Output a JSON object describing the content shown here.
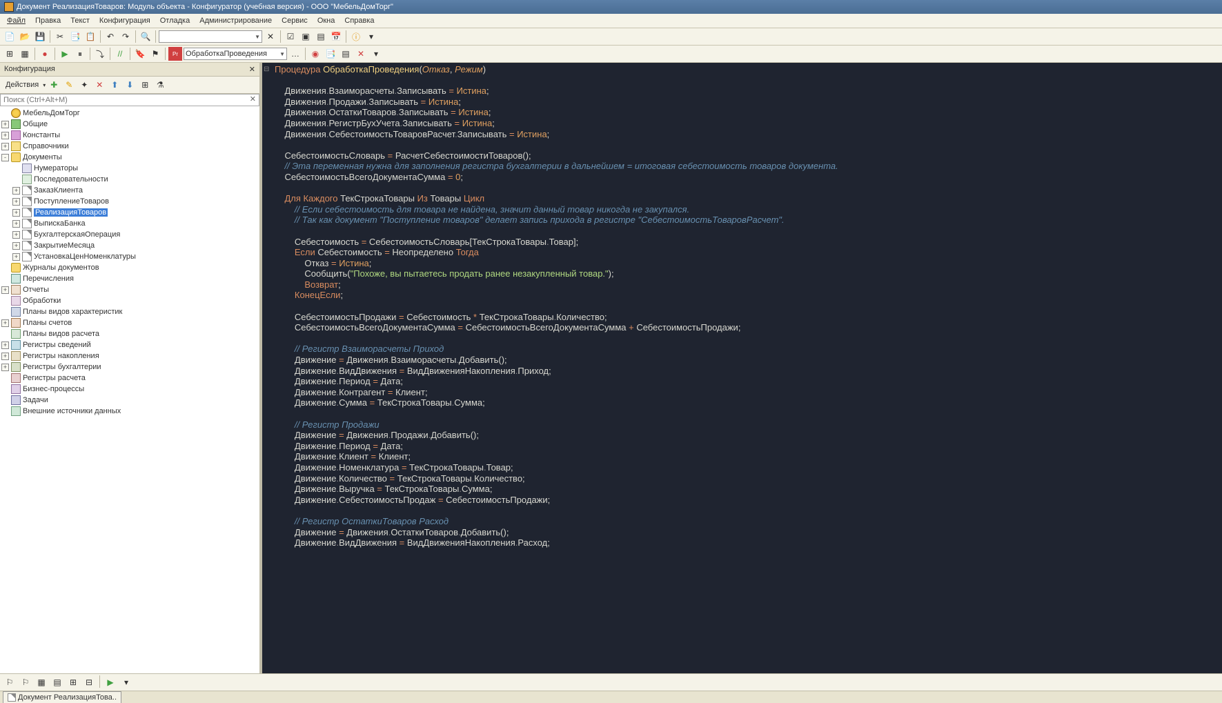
{
  "title": "Документ РеализацияТоваров: Модуль объекта - Конфигуратор (учебная версия) - ООО \"МебельДомТорг\"",
  "menu": [
    "Файл",
    "Правка",
    "Текст",
    "Конфигурация",
    "Отладка",
    "Администрирование",
    "Сервис",
    "Окна",
    "Справка"
  ],
  "proc_combo": "ОбработкаПроведения",
  "sidebar": {
    "title": "Конфигурация",
    "actions": "Действия",
    "search_placeholder": "Поиск (Ctrl+Alt+M)",
    "root": "МебельДомТорг",
    "nodes": [
      {
        "l": "Общие",
        "i": "node",
        "e": "+"
      },
      {
        "l": "Константы",
        "i": "const",
        "e": "+"
      },
      {
        "l": "Справочники",
        "i": "book",
        "e": "+"
      },
      {
        "l": "Документы",
        "i": "folder",
        "e": "-",
        "open": true
      },
      {
        "l": "Журналы документов",
        "i": "folder",
        "e": ""
      },
      {
        "l": "Перечисления",
        "i": "enum",
        "e": ""
      },
      {
        "l": "Отчеты",
        "i": "report",
        "e": "+"
      },
      {
        "l": "Обработки",
        "i": "proc",
        "e": ""
      },
      {
        "l": "Планы видов характеристик",
        "i": "char",
        "e": ""
      },
      {
        "l": "Планы счетов",
        "i": "acct",
        "e": "+"
      },
      {
        "l": "Планы видов расчета",
        "i": "calc",
        "e": ""
      },
      {
        "l": "Регистры сведений",
        "i": "reg",
        "e": "+"
      },
      {
        "l": "Регистры накопления",
        "i": "reg2",
        "e": "+"
      },
      {
        "l": "Регистры бухгалтерии",
        "i": "reg3",
        "e": "+"
      },
      {
        "l": "Регистры расчета",
        "i": "reg4",
        "e": ""
      },
      {
        "l": "Бизнес-процессы",
        "i": "biz",
        "e": ""
      },
      {
        "l": "Задачи",
        "i": "task",
        "e": ""
      },
      {
        "l": "Внешние источники данных",
        "i": "ext",
        "e": ""
      }
    ],
    "docs_children": [
      {
        "l": "Нумераторы",
        "i": "num",
        "e": ""
      },
      {
        "l": "Последовательности",
        "i": "seq",
        "e": ""
      },
      {
        "l": "ЗаказКлиента",
        "i": "doc",
        "e": "+"
      },
      {
        "l": "ПоступлениеТоваров",
        "i": "doc",
        "e": "+"
      },
      {
        "l": "РеализацияТоваров",
        "i": "doc",
        "e": "+",
        "sel": true
      },
      {
        "l": "ВыпискаБанка",
        "i": "doc",
        "e": "+"
      },
      {
        "l": "БухгалтерскаяОперация",
        "i": "doc",
        "e": "+"
      },
      {
        "l": "ЗакрытиеМесяца",
        "i": "doc",
        "e": "+"
      },
      {
        "l": "УстановкаЦенНоменклатуры",
        "i": "doc",
        "e": "+"
      }
    ]
  },
  "tab": "Документ РеализацияТова..",
  "code_lines": [
    [
      {
        "t": "Процедура ",
        "c": "kw"
      },
      {
        "t": "ОбработкаПроведения",
        "c": "fn"
      },
      {
        "t": "(",
        "c": "pn"
      },
      {
        "t": "Отказ",
        "c": "prm"
      },
      {
        "t": ", ",
        "c": "pn"
      },
      {
        "t": "Режим",
        "c": "prm"
      },
      {
        "t": ")",
        "c": "pn"
      }
    ],
    [],
    [
      {
        "t": "    Движения",
        "c": "id"
      },
      {
        "t": ".",
        "c": "dot"
      },
      {
        "t": "Взаиморасчеты",
        "c": "id"
      },
      {
        "t": ".",
        "c": "dot"
      },
      {
        "t": "Записывать ",
        "c": "id"
      },
      {
        "t": "= ",
        "c": "op"
      },
      {
        "t": "Истина",
        "c": "lit"
      },
      {
        "t": ";",
        "c": "pn"
      }
    ],
    [
      {
        "t": "    Движения",
        "c": "id"
      },
      {
        "t": ".",
        "c": "dot"
      },
      {
        "t": "Продажи",
        "c": "id"
      },
      {
        "t": ".",
        "c": "dot"
      },
      {
        "t": "Записывать ",
        "c": "id"
      },
      {
        "t": "= ",
        "c": "op"
      },
      {
        "t": "Истина",
        "c": "lit"
      },
      {
        "t": ";",
        "c": "pn"
      }
    ],
    [
      {
        "t": "    Движения",
        "c": "id"
      },
      {
        "t": ".",
        "c": "dot"
      },
      {
        "t": "ОстаткиТоваров",
        "c": "id"
      },
      {
        "t": ".",
        "c": "dot"
      },
      {
        "t": "Записывать ",
        "c": "id"
      },
      {
        "t": "= ",
        "c": "op"
      },
      {
        "t": "Истина",
        "c": "lit"
      },
      {
        "t": ";",
        "c": "pn"
      }
    ],
    [
      {
        "t": "    Движения",
        "c": "id"
      },
      {
        "t": ".",
        "c": "dot"
      },
      {
        "t": "РегистрБухУчета",
        "c": "id"
      },
      {
        "t": ".",
        "c": "dot"
      },
      {
        "t": "Записывать ",
        "c": "id"
      },
      {
        "t": "= ",
        "c": "op"
      },
      {
        "t": "Истина",
        "c": "lit"
      },
      {
        "t": ";",
        "c": "pn"
      }
    ],
    [
      {
        "t": "    Движения",
        "c": "id"
      },
      {
        "t": ".",
        "c": "dot"
      },
      {
        "t": "СебестоимостьТоваровРасчет",
        "c": "id"
      },
      {
        "t": ".",
        "c": "dot"
      },
      {
        "t": "Записывать ",
        "c": "id"
      },
      {
        "t": "= ",
        "c": "op"
      },
      {
        "t": "Истина",
        "c": "lit"
      },
      {
        "t": ";",
        "c": "pn"
      }
    ],
    [],
    [
      {
        "t": "    СебестоимостьСловарь ",
        "c": "id"
      },
      {
        "t": "= ",
        "c": "op"
      },
      {
        "t": "РасчетСебестоимостиТоваров",
        "c": "id"
      },
      {
        "t": "();",
        "c": "pn"
      }
    ],
    [
      {
        "t": "    // Эта переменная нужна для заполнения регистра бухгалтерии в дальнейшем = итоговая себестоимость товаров документа.",
        "c": "cmt"
      }
    ],
    [
      {
        "t": "    СебестоимостьВсегоДокументаСумма ",
        "c": "id"
      },
      {
        "t": "= ",
        "c": "op"
      },
      {
        "t": "0",
        "c": "num"
      },
      {
        "t": ";",
        "c": "pn"
      }
    ],
    [],
    [
      {
        "t": "    Для Каждого ",
        "c": "kw"
      },
      {
        "t": "ТекСтрокаТовары ",
        "c": "id"
      },
      {
        "t": "Из ",
        "c": "kw"
      },
      {
        "t": "Товары ",
        "c": "id"
      },
      {
        "t": "Цикл",
        "c": "kw"
      }
    ],
    [
      {
        "t": "        // Если себестоимость для товара не найдена, значит данный товар никогда не закупался.",
        "c": "cmt"
      }
    ],
    [
      {
        "t": "        // Так как документ \"Поступление товаров\" делает запись прихода в регистре \"СебестоимостьТоваровРасчет\".",
        "c": "cmt"
      }
    ],
    [],
    [
      {
        "t": "        Себестоимость ",
        "c": "id"
      },
      {
        "t": "= ",
        "c": "op"
      },
      {
        "t": "СебестоимостьСловарь",
        "c": "id"
      },
      {
        "t": "[",
        "c": "pn"
      },
      {
        "t": "ТекСтрокаТовары",
        "c": "id"
      },
      {
        "t": ".",
        "c": "dot"
      },
      {
        "t": "Товар",
        "c": "id"
      },
      {
        "t": "];",
        "c": "pn"
      }
    ],
    [
      {
        "t": "        Если ",
        "c": "kw"
      },
      {
        "t": "Себестоимость ",
        "c": "id"
      },
      {
        "t": "= ",
        "c": "op"
      },
      {
        "t": "Неопределено ",
        "c": "id"
      },
      {
        "t": "Тогда",
        "c": "kw"
      }
    ],
    [
      {
        "t": "            Отказ ",
        "c": "id"
      },
      {
        "t": "= ",
        "c": "op"
      },
      {
        "t": "Истина",
        "c": "lit"
      },
      {
        "t": ";",
        "c": "pn"
      }
    ],
    [
      {
        "t": "            Сообщить",
        "c": "id"
      },
      {
        "t": "(",
        "c": "pn"
      },
      {
        "t": "\"Похоже, вы пытаетесь продать ранее незакупленный товар.\"",
        "c": "str"
      },
      {
        "t": ");",
        "c": "pn"
      }
    ],
    [
      {
        "t": "            Возврат",
        "c": "kw"
      },
      {
        "t": ";",
        "c": "pn"
      }
    ],
    [
      {
        "t": "        КонецЕсли",
        "c": "kw"
      },
      {
        "t": ";",
        "c": "pn"
      }
    ],
    [],
    [
      {
        "t": "        СебестоимостьПродажи ",
        "c": "id"
      },
      {
        "t": "= ",
        "c": "op"
      },
      {
        "t": "Себестоимость ",
        "c": "id"
      },
      {
        "t": "* ",
        "c": "op"
      },
      {
        "t": "ТекСтрокаТовары",
        "c": "id"
      },
      {
        "t": ".",
        "c": "dot"
      },
      {
        "t": "Количество",
        "c": "id"
      },
      {
        "t": ";",
        "c": "pn"
      }
    ],
    [
      {
        "t": "        СебестоимостьВсегоДокументаСумма ",
        "c": "id"
      },
      {
        "t": "= ",
        "c": "op"
      },
      {
        "t": "СебестоимостьВсегоДокументаСумма ",
        "c": "id"
      },
      {
        "t": "+ ",
        "c": "op"
      },
      {
        "t": "СебестоимостьПродажи",
        "c": "id"
      },
      {
        "t": ";",
        "c": "pn"
      }
    ],
    [],
    [
      {
        "t": "        // Регистр Взаиморасчеты Приход",
        "c": "cmt"
      }
    ],
    [
      {
        "t": "        Движение ",
        "c": "id"
      },
      {
        "t": "= ",
        "c": "op"
      },
      {
        "t": "Движения",
        "c": "id"
      },
      {
        "t": ".",
        "c": "dot"
      },
      {
        "t": "Взаиморасчеты",
        "c": "id"
      },
      {
        "t": ".",
        "c": "dot"
      },
      {
        "t": "Добавить",
        "c": "id"
      },
      {
        "t": "();",
        "c": "pn"
      }
    ],
    [
      {
        "t": "        Движение",
        "c": "id"
      },
      {
        "t": ".",
        "c": "dot"
      },
      {
        "t": "ВидДвижения ",
        "c": "id"
      },
      {
        "t": "= ",
        "c": "op"
      },
      {
        "t": "ВидДвиженияНакопления",
        "c": "id"
      },
      {
        "t": ".",
        "c": "dot"
      },
      {
        "t": "Приход",
        "c": "id"
      },
      {
        "t": ";",
        "c": "pn"
      }
    ],
    [
      {
        "t": "        Движение",
        "c": "id"
      },
      {
        "t": ".",
        "c": "dot"
      },
      {
        "t": "Период ",
        "c": "id"
      },
      {
        "t": "= ",
        "c": "op"
      },
      {
        "t": "Дата",
        "c": "id"
      },
      {
        "t": ";",
        "c": "pn"
      }
    ],
    [
      {
        "t": "        Движение",
        "c": "id"
      },
      {
        "t": ".",
        "c": "dot"
      },
      {
        "t": "Контрагент ",
        "c": "id"
      },
      {
        "t": "= ",
        "c": "op"
      },
      {
        "t": "Клиент",
        "c": "id"
      },
      {
        "t": ";",
        "c": "pn"
      }
    ],
    [
      {
        "t": "        Движение",
        "c": "id"
      },
      {
        "t": ".",
        "c": "dot"
      },
      {
        "t": "Сумма ",
        "c": "id"
      },
      {
        "t": "= ",
        "c": "op"
      },
      {
        "t": "ТекСтрокаТовары",
        "c": "id"
      },
      {
        "t": ".",
        "c": "dot"
      },
      {
        "t": "Сумма",
        "c": "id"
      },
      {
        "t": ";",
        "c": "pn"
      }
    ],
    [],
    [
      {
        "t": "        // Регистр Продажи",
        "c": "cmt"
      }
    ],
    [
      {
        "t": "        Движение ",
        "c": "id"
      },
      {
        "t": "= ",
        "c": "op"
      },
      {
        "t": "Движения",
        "c": "id"
      },
      {
        "t": ".",
        "c": "dot"
      },
      {
        "t": "Продажи",
        "c": "id"
      },
      {
        "t": ".",
        "c": "dot"
      },
      {
        "t": "Добавить",
        "c": "id"
      },
      {
        "t": "();",
        "c": "pn"
      }
    ],
    [
      {
        "t": "        Движение",
        "c": "id"
      },
      {
        "t": ".",
        "c": "dot"
      },
      {
        "t": "Период ",
        "c": "id"
      },
      {
        "t": "= ",
        "c": "op"
      },
      {
        "t": "Дата",
        "c": "id"
      },
      {
        "t": ";",
        "c": "pn"
      }
    ],
    [
      {
        "t": "        Движение",
        "c": "id"
      },
      {
        "t": ".",
        "c": "dot"
      },
      {
        "t": "Клиент ",
        "c": "id"
      },
      {
        "t": "= ",
        "c": "op"
      },
      {
        "t": "Клиент",
        "c": "id"
      },
      {
        "t": ";",
        "c": "pn"
      }
    ],
    [
      {
        "t": "        Движение",
        "c": "id"
      },
      {
        "t": ".",
        "c": "dot"
      },
      {
        "t": "Номенклатура ",
        "c": "id"
      },
      {
        "t": "= ",
        "c": "op"
      },
      {
        "t": "ТекСтрокаТовары",
        "c": "id"
      },
      {
        "t": ".",
        "c": "dot"
      },
      {
        "t": "Товар",
        "c": "id"
      },
      {
        "t": ";",
        "c": "pn"
      }
    ],
    [
      {
        "t": "        Движение",
        "c": "id"
      },
      {
        "t": ".",
        "c": "dot"
      },
      {
        "t": "Количество ",
        "c": "id"
      },
      {
        "t": "= ",
        "c": "op"
      },
      {
        "t": "ТекСтрокаТовары",
        "c": "id"
      },
      {
        "t": ".",
        "c": "dot"
      },
      {
        "t": "Количество",
        "c": "id"
      },
      {
        "t": ";",
        "c": "pn"
      }
    ],
    [
      {
        "t": "        Движение",
        "c": "id"
      },
      {
        "t": ".",
        "c": "dot"
      },
      {
        "t": "Выручка ",
        "c": "id"
      },
      {
        "t": "= ",
        "c": "op"
      },
      {
        "t": "ТекСтрокаТовары",
        "c": "id"
      },
      {
        "t": ".",
        "c": "dot"
      },
      {
        "t": "Сумма",
        "c": "id"
      },
      {
        "t": ";",
        "c": "pn"
      }
    ],
    [
      {
        "t": "        Движение",
        "c": "id"
      },
      {
        "t": ".",
        "c": "dot"
      },
      {
        "t": "СебестоимостьПродаж ",
        "c": "id"
      },
      {
        "t": "= ",
        "c": "op"
      },
      {
        "t": "СебестоимостьПродажи",
        "c": "id"
      },
      {
        "t": ";",
        "c": "pn"
      }
    ],
    [],
    [
      {
        "t": "        // Регистр ОстаткиТоваров Расход",
        "c": "cmt"
      }
    ],
    [
      {
        "t": "        Движение ",
        "c": "id"
      },
      {
        "t": "= ",
        "c": "op"
      },
      {
        "t": "Движения",
        "c": "id"
      },
      {
        "t": ".",
        "c": "dot"
      },
      {
        "t": "ОстаткиТоваров",
        "c": "id"
      },
      {
        "t": ".",
        "c": "dot"
      },
      {
        "t": "Добавить",
        "c": "id"
      },
      {
        "t": "();",
        "c": "pn"
      }
    ],
    [
      {
        "t": "        Движение",
        "c": "id"
      },
      {
        "t": ".",
        "c": "dot"
      },
      {
        "t": "ВидДвижения ",
        "c": "id"
      },
      {
        "t": "= ",
        "c": "op"
      },
      {
        "t": "ВидДвиженияНакопления",
        "c": "id"
      },
      {
        "t": ".",
        "c": "dot"
      },
      {
        "t": "Расход",
        "c": "id"
      },
      {
        "t": ";",
        "c": "pn"
      }
    ]
  ]
}
